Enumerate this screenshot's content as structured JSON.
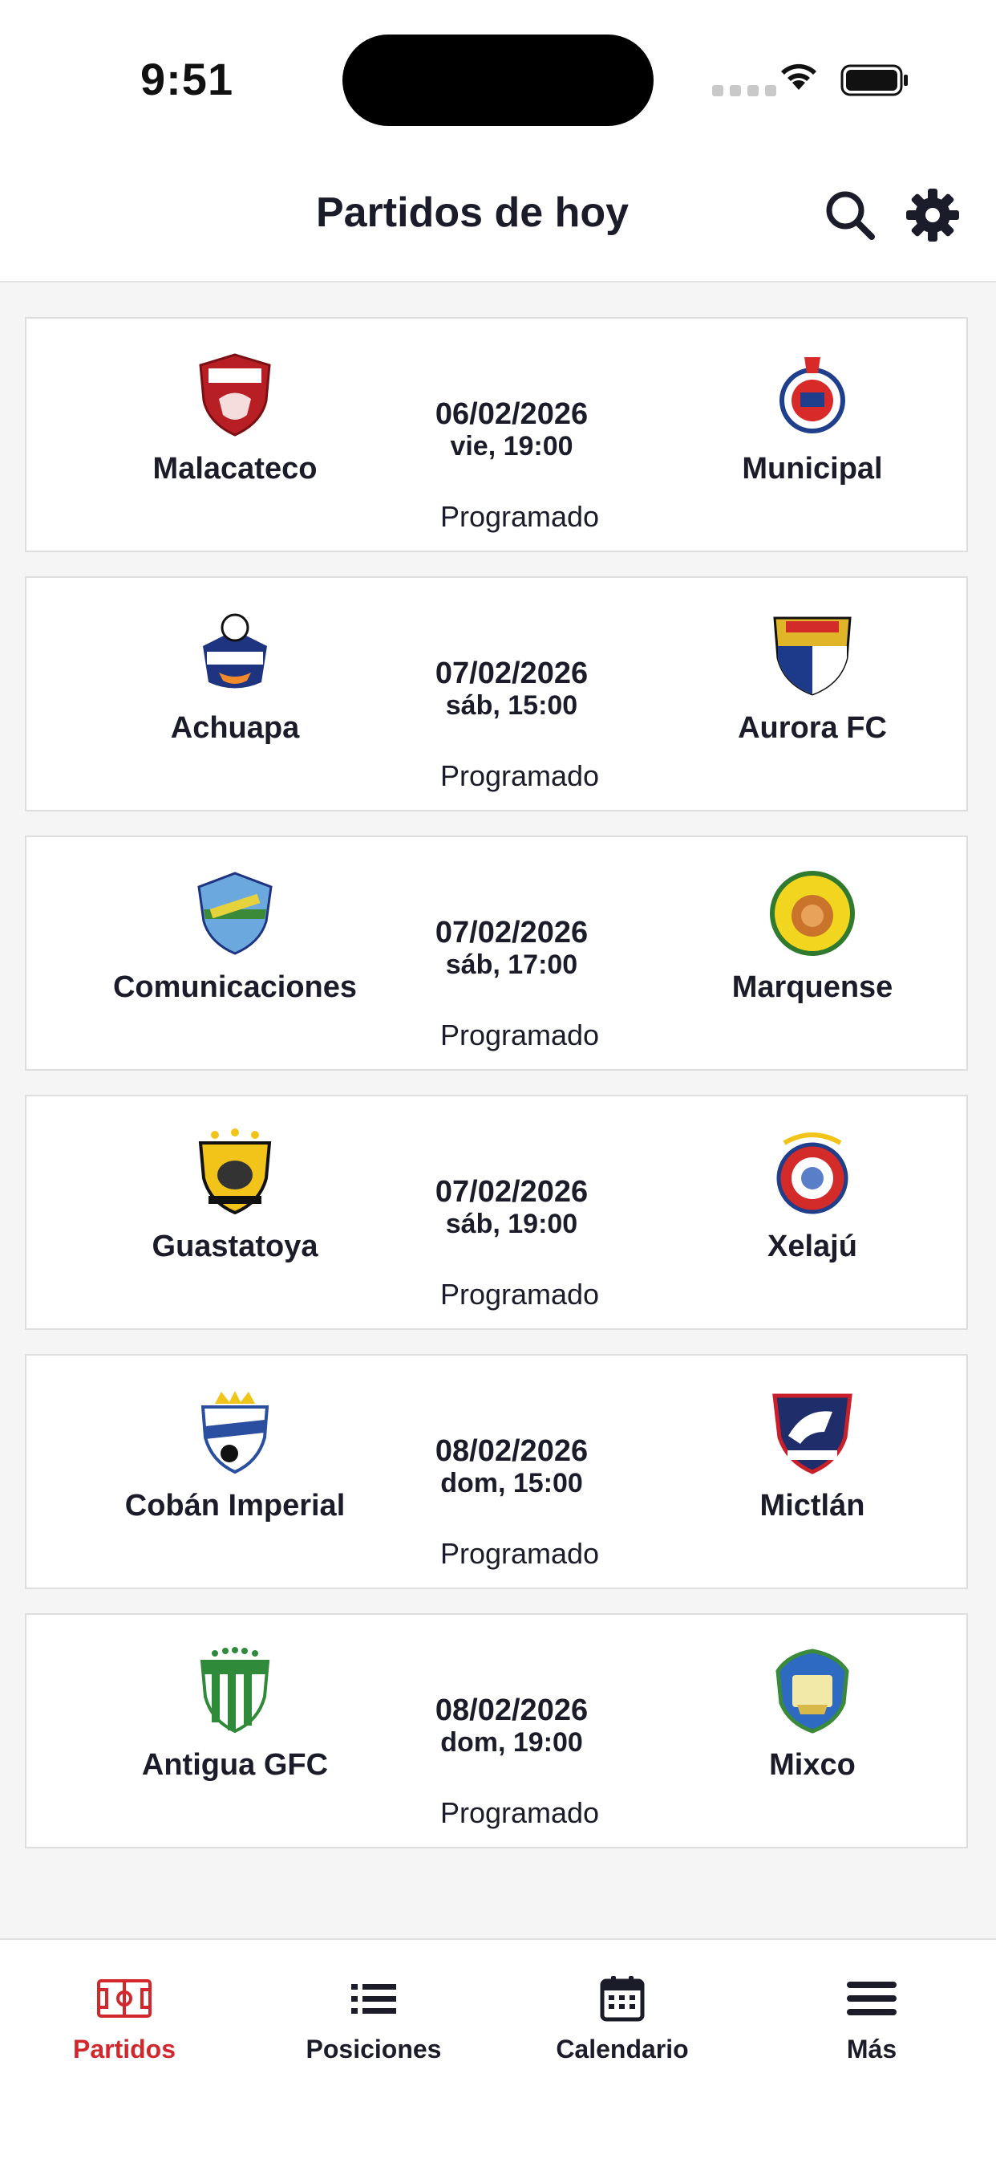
{
  "status_bar": {
    "time": "9:51"
  },
  "header": {
    "title": "Partidos de hoy"
  },
  "colors": {
    "accent": "#d3272e",
    "text": "#1a1d29",
    "background": "#f5f5f5"
  },
  "matches": [
    {
      "home": "Malacateco",
      "away": "Municipal",
      "date": "06/02/2026",
      "datetime": "vie, 19:00",
      "status": "Programado"
    },
    {
      "home": "Achuapa",
      "away": "Aurora FC",
      "date": "07/02/2026",
      "datetime": "sáb, 15:00",
      "status": "Programado"
    },
    {
      "home": "Comunicaciones",
      "away": "Marquense",
      "date": "07/02/2026",
      "datetime": "sáb, 17:00",
      "status": "Programado"
    },
    {
      "home": "Guastatoya",
      "away": "Xelajú",
      "date": "07/02/2026",
      "datetime": "sáb, 19:00",
      "status": "Programado"
    },
    {
      "home": "Cobán Imperial",
      "away": "Mictlán",
      "date": "08/02/2026",
      "datetime": "dom, 15:00",
      "status": "Programado"
    },
    {
      "home": "Antigua GFC",
      "away": "Mixco",
      "date": "08/02/2026",
      "datetime": "dom, 19:00",
      "status": "Programado"
    }
  ],
  "tabs": [
    {
      "label": "Partidos",
      "icon": "field-icon",
      "active": true
    },
    {
      "label": "Posiciones",
      "icon": "list-icon",
      "active": false
    },
    {
      "label": "Calendario",
      "icon": "calendar-icon",
      "active": false
    },
    {
      "label": "Más",
      "icon": "menu-icon",
      "active": false
    }
  ]
}
